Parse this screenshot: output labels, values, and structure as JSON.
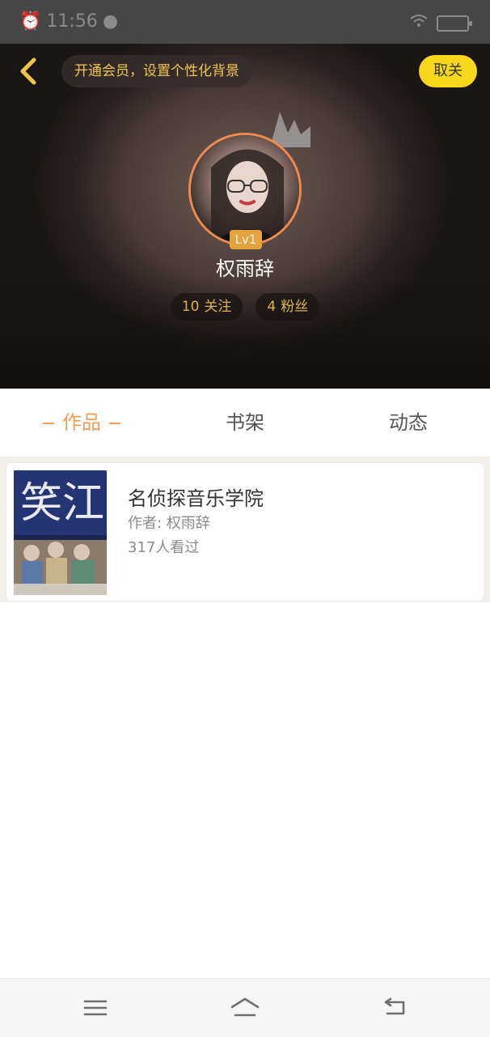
{
  "status_bar": {
    "time": "11:56"
  },
  "header": {
    "promo_text": "开通会员，设置个性化背景",
    "unfollow_label": "取关"
  },
  "profile": {
    "level_badge": "Lv1",
    "username": "权雨辞",
    "following_count": "10",
    "following_label": "关注",
    "fans_count": "4",
    "fans_label": "粉丝"
  },
  "tabs": [
    {
      "label": "作品",
      "active": true
    },
    {
      "label": "书架",
      "active": false
    },
    {
      "label": "动态",
      "active": false
    }
  ],
  "works": [
    {
      "title": "名侦探音乐学院",
      "author": "作者: 权雨辞",
      "views": "317人看过"
    }
  ],
  "colors": {
    "accent_orange": "#f39c5a",
    "gold": "#f2c64d",
    "unfollow_bg": "#f9d71c"
  },
  "icons": [
    "back-chevron-icon",
    "crown-icon",
    "menu-icon",
    "home-icon",
    "back-icon"
  ]
}
